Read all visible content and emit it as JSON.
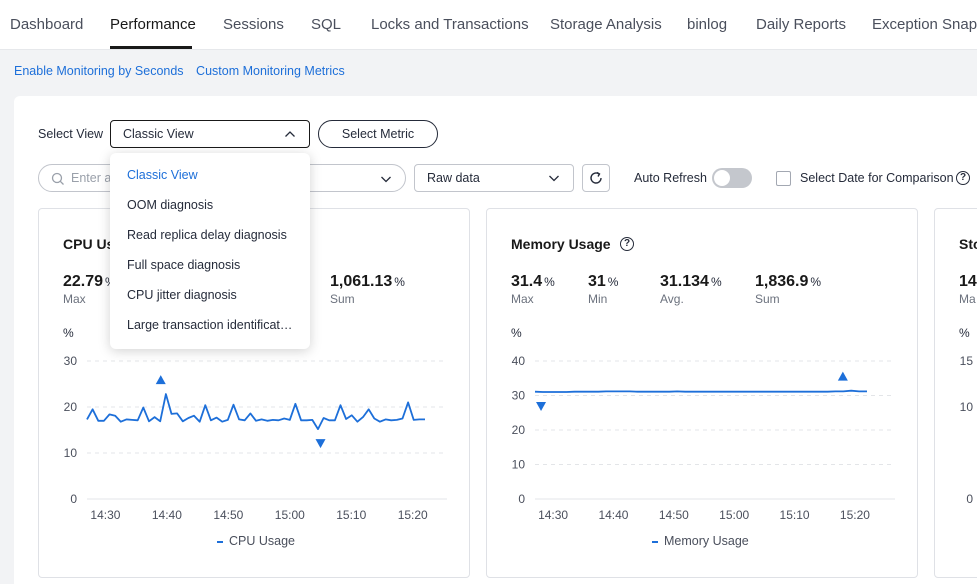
{
  "tabs": [
    "Dashboard",
    "Performance",
    "Sessions",
    "SQL",
    "Locks and Transactions",
    "Storage Analysis",
    "binlog",
    "Daily Reports",
    "Exception Snapshots"
  ],
  "active_tab": "Performance",
  "links": {
    "monitor_seconds": "Enable Monitoring by Seconds",
    "custom_metrics": "Custom Monitoring Metrics"
  },
  "toolbar": {
    "select_view_label": "Select View",
    "select_view_value": "Classic View",
    "select_metric_button": "Select Metric",
    "search_placeholder": "Enter a",
    "data_mode_value": "Raw data",
    "auto_refresh_label": "Auto Refresh",
    "auto_refresh_on": false,
    "compare_label": "Select Date for Comparison",
    "compare_checked": false
  },
  "view_dropdown": {
    "options": [
      "Classic View",
      "OOM diagnosis",
      "Read replica delay diagnosis",
      "Full space diagnosis",
      "CPU jitter diagnosis",
      "Large transaction identification"
    ],
    "selected": "Classic View"
  },
  "accent_color": "#1d6fd9",
  "cards": [
    {
      "title": "CPU Usage",
      "stats": [
        {
          "value": "22.79",
          "unit": "%",
          "label": "Max"
        },
        {
          "value": "1,061.13",
          "unit": "%",
          "label": "Sum"
        }
      ],
      "legend": "CPU Usage"
    },
    {
      "title": "Memory Usage",
      "stats": [
        {
          "value": "31.4",
          "unit": "%",
          "label": "Max"
        },
        {
          "value": "31",
          "unit": "%",
          "label": "Min"
        },
        {
          "value": "31.134",
          "unit": "%",
          "label": "Avg."
        },
        {
          "value": "1,836.9",
          "unit": "%",
          "label": "Sum"
        }
      ],
      "legend": "Memory Usage"
    },
    {
      "title": "Sto",
      "stats": [
        {
          "value": "14",
          "unit": "",
          "label": "Ma"
        }
      ],
      "legend": ""
    }
  ],
  "chart_data": [
    {
      "type": "line",
      "title": "CPU Usage",
      "ylabel": "%",
      "ylim": [
        0,
        30
      ],
      "yticks": [
        "30",
        "20",
        "10",
        "0"
      ],
      "xticks": [
        "14:30",
        "14:40",
        "14:50",
        "15:00",
        "15:10",
        "15:20"
      ],
      "x_start": "14:27",
      "x_end": "15:22",
      "series": [
        {
          "name": "CPU Usage",
          "values": [
            17.3,
            19.5,
            17,
            17,
            18.4,
            18.1,
            16.8,
            17.3,
            17.2,
            17.1,
            19.9,
            16.9,
            17.8,
            16.9,
            22.8,
            18.5,
            18.6,
            16.9,
            17.6,
            18.1,
            16.8,
            20.4,
            17.1,
            17.7,
            16.8,
            17.2,
            20.5,
            17.3,
            17.1,
            18.6,
            17,
            17.3,
            17,
            17.2,
            17.1,
            17.5,
            17.2,
            20.7,
            17.1,
            17.1,
            17.2,
            15.2,
            17.6,
            17.1,
            17.1,
            20.4,
            17.4,
            18.2,
            16.8,
            17.8,
            19.5,
            17.5,
            16.8,
            17.3,
            17.1,
            17.2,
            17.5,
            21,
            17.2,
            17.3,
            17.3
          ]
        }
      ],
      "annotations": [
        {
          "type": "max",
          "value": 22.79,
          "x": "14:39"
        },
        {
          "type": "min",
          "value": 15.2,
          "x": "15:05"
        }
      ]
    },
    {
      "type": "line",
      "title": "Memory Usage",
      "ylabel": "%",
      "ylim": [
        0,
        40
      ],
      "yticks": [
        "40",
        "30",
        "20",
        "10",
        "0"
      ],
      "xticks": [
        "14:30",
        "14:40",
        "14:50",
        "15:00",
        "15:10",
        "15:20"
      ],
      "x_start": "14:27",
      "x_end": "15:22",
      "series": [
        {
          "name": "Memory Usage",
          "values": [
            31.1,
            31,
            31,
            31,
            31,
            31.1,
            31.1,
            31.1,
            31.1,
            31.2,
            31.2,
            31.2,
            31.2,
            31.1,
            31.1,
            31.1,
            31.1,
            31.1,
            31.2,
            31.1,
            31.1,
            31.1,
            31.1,
            31.1,
            31.1,
            31.1,
            31.1,
            31.1,
            31.1,
            31.1,
            31.1,
            31.1,
            31.1,
            31.1,
            31.1,
            31.1,
            31.1,
            31.1,
            31.2,
            31.2,
            31.4,
            31.2,
            31.2
          ]
        }
      ],
      "annotations": [
        {
          "type": "max",
          "value": 31.4,
          "x": "15:18"
        },
        {
          "type": "min",
          "value": 31,
          "x": "14:28"
        }
      ]
    },
    {
      "type": "line",
      "title": "Sto",
      "ylabel": "%",
      "yticks": [
        "15",
        "10",
        "0"
      ],
      "series": []
    }
  ]
}
